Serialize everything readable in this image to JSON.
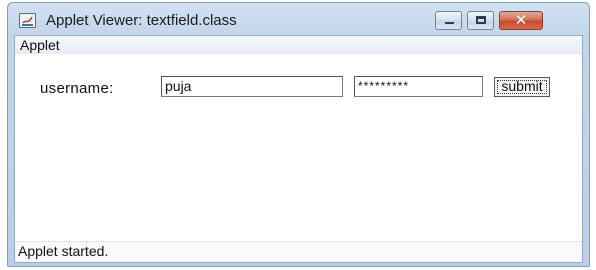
{
  "window": {
    "title": "Applet Viewer: textfield.class",
    "icon": "java-applet-icon",
    "controls": {
      "minimize_icon": "minimize-icon",
      "maximize_icon": "maximize-icon",
      "close_glyph": "✕"
    }
  },
  "menubar": {
    "items": [
      {
        "label": "Applet"
      }
    ]
  },
  "form": {
    "username_label": "username:",
    "username_value": "puja",
    "password_value": "*********",
    "submit_label": "submit"
  },
  "status": {
    "text": "Applet started."
  },
  "colors": {
    "title_bar": "#c3d6ec",
    "close_button": "#c74a2c",
    "client_background": "#ffffff"
  }
}
